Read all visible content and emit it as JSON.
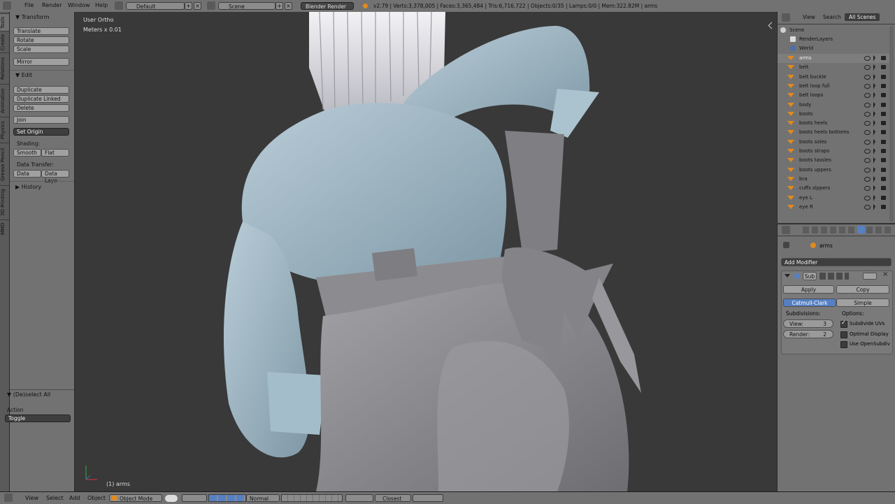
{
  "topbar": {
    "menus": [
      "File",
      "Render",
      "Window",
      "Help"
    ],
    "layout": "Default",
    "scene": "Scene",
    "render_engine": "Blender Render",
    "stats": "v2.79 | Verts:3,378,005 | Faces:3,365,484 | Tris:6,716,722 | Objects:0/35 | Lamps:0/0 | Mem:322.82M | arms"
  },
  "tabs": [
    "Tools",
    "Create",
    "Relations",
    "Animation",
    "Physics",
    "Grease Pencil",
    "3D Printing",
    "MMD"
  ],
  "toolshelf": {
    "transform_header": "Transform",
    "translate": "Translate",
    "rotate": "Rotate",
    "scale": "Scale",
    "mirror": "Mirror",
    "edit_header": "Edit",
    "duplicate": "Duplicate",
    "duplicate_linked": "Duplicate Linked",
    "delete": "Delete",
    "join": "Join",
    "set_origin": "Set Origin",
    "shading_label": "Shading:",
    "smooth": "Smooth",
    "flat": "Flat",
    "data_transfer_label": "Data Transfer:",
    "data": "Data",
    "data_layout": "Data Layo",
    "history_header": "History",
    "deselect_header": "(De)select All",
    "action_label": "Action",
    "action_value": "Toggle"
  },
  "viewport": {
    "view_name": "User Ortho",
    "units": "Meters x 0.01",
    "active_object": "(1) arms"
  },
  "outliner": {
    "tabs": [
      "View",
      "Search",
      "All Scenes"
    ],
    "scene": "Scene",
    "render_layers": "RenderLayers",
    "world": "World",
    "objects": [
      "arms",
      "belt",
      "belt buckle",
      "belt loop full",
      "belt loops",
      "body",
      "boots",
      "boots heels",
      "boots heels bottoms",
      "boots soles",
      "boots straps",
      "boots tassles",
      "boots uppers",
      "bra",
      "cuffs zippers",
      "eye L",
      "eye R"
    ]
  },
  "properties": {
    "object_name": "arms",
    "add_modifier": "Add Modifier",
    "modifier_name": "Sub",
    "apply": "Apply",
    "copy": "Copy",
    "catmull_clark": "Catmull-Clark",
    "simple": "Simple",
    "subdivisions_label": "Subdivisions:",
    "options_label": "Options:",
    "view_label": "View:",
    "view_value": "3",
    "render_label": "Render:",
    "render_value": "2",
    "subdivide_uvs": "Subdivide UVs",
    "optimal_display": "Optimal Display",
    "use_opensubdiv": "Use OpenSubdiv"
  },
  "bottombar": {
    "menus": [
      "View",
      "Select",
      "Add",
      "Object"
    ],
    "mode": "Object Mode",
    "pivot": "Normal",
    "snap": "Closest"
  },
  "colors": {
    "accent_blue": "#5680c2",
    "orange_object": "#e08a1e",
    "shirt": "#9fb7c4",
    "pants": "#8a8a8e"
  }
}
